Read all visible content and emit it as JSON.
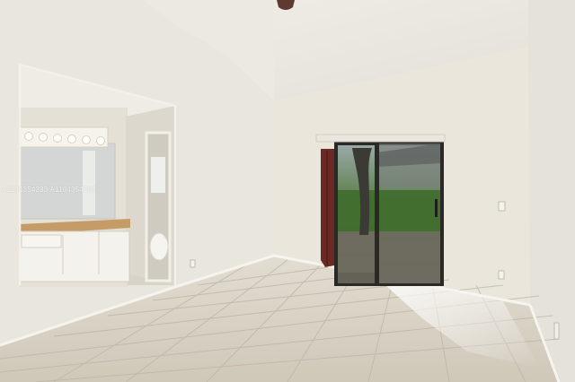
{
  "photo": {
    "watermark": "A1184354283 A1184354283",
    "subject": "empty-bedroom-with-sliding-door-and-bathroom-view"
  },
  "colors": {
    "ceiling": "#eeece4",
    "wall_left": "#eae7df",
    "wall_back": "#ebe6dd",
    "wall_right": "#e6e3dc",
    "floor": "#d9d3c6",
    "grout": "#bfb8aa",
    "curtain": "#6b2a24",
    "door_frame": "#2a2926",
    "outdoor_green": "#4f7a3a",
    "countertop": "#c7a06c"
  },
  "icons": {
    "ceiling_fan": "ceiling-fan-icon",
    "outlet": "outlet-icon",
    "light_switch": "light-switch-icon"
  }
}
